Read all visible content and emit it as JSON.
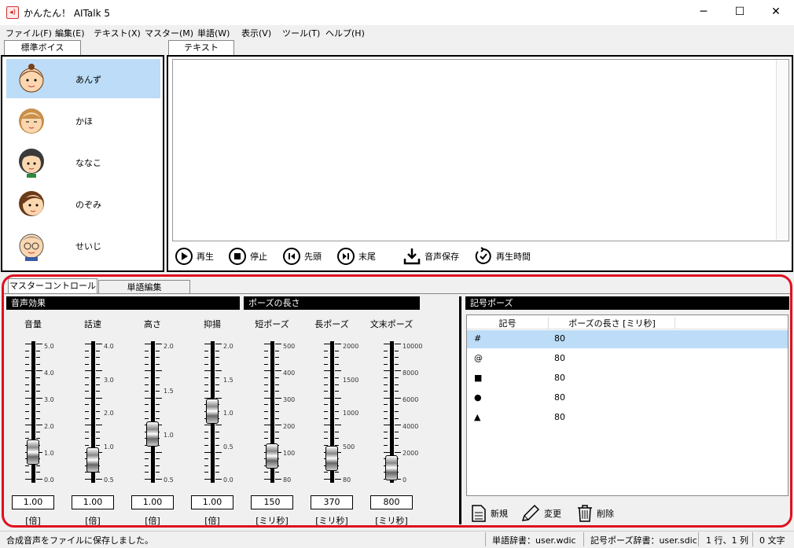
{
  "app": {
    "title": "かんたん！ AITalk 5",
    "icon": "speaker-icon"
  },
  "window": {
    "minimize": "─",
    "maximize": "☐",
    "close": "✕"
  },
  "menu": [
    "ファイル(F)",
    "編集(E)",
    "テキスト(X)",
    "マスター(M)",
    "単語(W)",
    "表示(V)",
    "ツール(T)",
    "ヘルプ(H)"
  ],
  "voice_tab": "標準ボイス",
  "voices": [
    {
      "name": "あんず",
      "selected": true
    },
    {
      "name": "かほ"
    },
    {
      "name": "ななこ"
    },
    {
      "name": "のぞみ"
    },
    {
      "name": "せいじ"
    }
  ],
  "text_tab": "テキスト",
  "text_content": "",
  "controls": {
    "play": "再生",
    "stop": "停止",
    "head": "先頭",
    "tail": "末尾",
    "save": "音声保存",
    "time": "再生時間"
  },
  "bottom_tabs": [
    "マスターコントロール",
    "単語編集"
  ],
  "sections": {
    "effects": "音声効果",
    "pause": "ポーズの長さ",
    "symbol": "記号ポーズ"
  },
  "sliders": [
    {
      "label": "音量",
      "ticks": [
        "5.0",
        "4.0",
        "3.0",
        "2.0",
        "1.0",
        "0.0"
      ],
      "value": "1.00",
      "unit": "[倍]",
      "level": 0.2
    },
    {
      "label": "話速",
      "ticks": [
        "4.0",
        "3.0",
        "2.0",
        "1.0",
        "0.5"
      ],
      "value": "1.00",
      "unit": "[倍]",
      "level": 0.14
    },
    {
      "label": "高さ",
      "ticks": [
        "2.0",
        "1.5",
        "1.0",
        "0.5"
      ],
      "value": "1.00",
      "unit": "[倍]",
      "level": 0.33
    },
    {
      "label": "抑揚",
      "ticks": [
        "2.0",
        "1.5",
        "1.0",
        "0.5",
        "0.0"
      ],
      "value": "1.00",
      "unit": "[倍]",
      "level": 0.5
    },
    {
      "label": "短ポーズ",
      "ticks": [
        "500",
        "400",
        "300",
        "200",
        "100",
        "80"
      ],
      "value": "150",
      "unit": "[ミリ秒]",
      "level": 0.17
    },
    {
      "label": "長ポーズ",
      "ticks": [
        "2000",
        "1500",
        "1000",
        "500",
        "80"
      ],
      "value": "370",
      "unit": "[ミリ秒]",
      "level": 0.15
    },
    {
      "label": "文末ポーズ",
      "ticks": [
        "10000",
        "8000",
        "6000",
        "4000",
        "2000",
        "0"
      ],
      "value": "800",
      "unit": "[ミリ秒]",
      "level": 0.08
    }
  ],
  "symbol_table": {
    "headers": [
      "記号",
      "ポーズの長さ [ミリ秒]"
    ],
    "rows": [
      [
        "#",
        "80"
      ],
      [
        "@",
        "80"
      ],
      [
        "■",
        "80"
      ],
      [
        "●",
        "80"
      ],
      [
        "▲",
        "80"
      ]
    ]
  },
  "symbol_buttons": {
    "new": "新規",
    "edit": "変更",
    "delete": "削除"
  },
  "status": {
    "message": "合成音声をファイルに保存しました。",
    "word_dict": "単語辞書：user.wdic",
    "symbol_dict": "記号ポーズ辞書：user.sdic",
    "position": "1 行、1 列",
    "chars": "0 文字"
  },
  "colors": {
    "highlight": "#e01020",
    "selection": "#bcdcf8"
  }
}
